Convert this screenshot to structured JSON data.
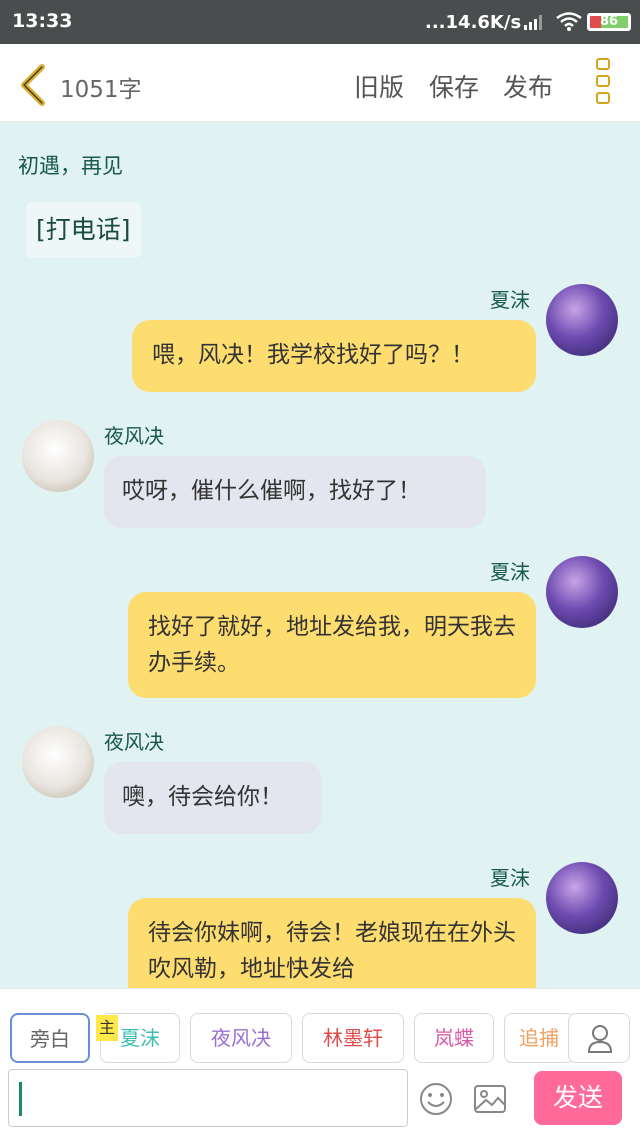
{
  "status_bar": {
    "time": "13:33",
    "speed": "...14.6K/s",
    "battery": "86"
  },
  "header": {
    "word_count": "1051字",
    "old_version": "旧版",
    "save": "保存",
    "publish": "发布"
  },
  "chat": {
    "title": "初遇，再见",
    "narration": "[打电话]",
    "messages": [
      {
        "speaker": "夏沫",
        "side": "right",
        "text": "喂，风决！我学校找好了吗？！"
      },
      {
        "speaker": "夜风决",
        "side": "left",
        "text": "哎呀，催什么催啊，找好了！"
      },
      {
        "speaker": "夏沫",
        "side": "right",
        "text": "找好了就好，地址发给我，明天我去办手续。"
      },
      {
        "speaker": "夜风决",
        "side": "left",
        "text": "噢，待会给你！"
      },
      {
        "speaker": "夏沫",
        "side": "right",
        "text": "待会你妹啊，待会！老娘现在在外头吹风勒，地址快发给"
      }
    ]
  },
  "roles": {
    "narrator": "旁白",
    "main_badge": "主",
    "chips": [
      {
        "label": "夏沫",
        "color": "#3fbfb0"
      },
      {
        "label": "夜风决",
        "color": "#9a6fd0"
      },
      {
        "label": "林墨轩",
        "color": "#e04a4a"
      },
      {
        "label": "岚蝶",
        "color": "#d85aa8"
      },
      {
        "label": "追捕",
        "color": "#f0a060"
      }
    ]
  },
  "composer": {
    "send": "发送"
  },
  "icons": [
    "back-arrow-icon",
    "menu-icon",
    "user-icon",
    "emoji-icon",
    "image-icon"
  ]
}
